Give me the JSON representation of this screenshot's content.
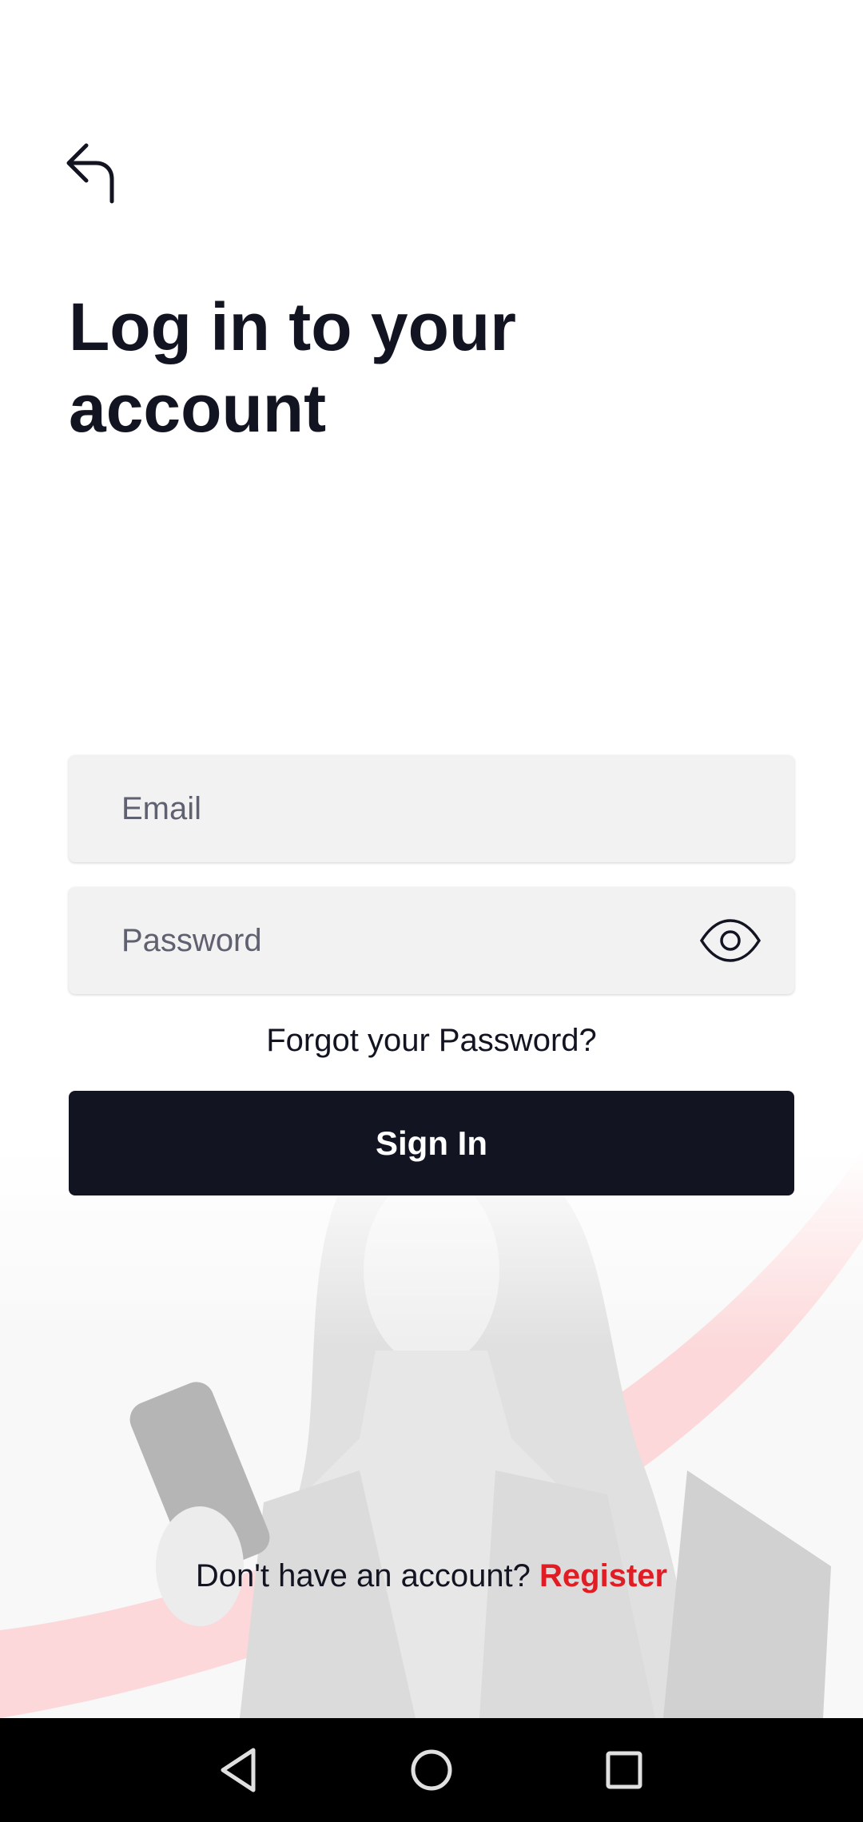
{
  "header": {
    "back_icon": "back-arrow-icon",
    "title": "Log in to your account"
  },
  "form": {
    "email_placeholder": "Email",
    "password_placeholder": "Password",
    "eye_icon": "eye-icon",
    "forgot_password": "Forgot your Password?",
    "sign_in": "Sign In"
  },
  "footer": {
    "prompt": "Don't have an account?",
    "register": "Register"
  },
  "nav": {
    "back_icon": "nav-back-icon",
    "home_icon": "nav-home-icon",
    "recents_icon": "nav-recents-icon"
  },
  "colors": {
    "primary": "#121421",
    "accent": "#e01c24",
    "field_bg": "#f2f2f2"
  }
}
